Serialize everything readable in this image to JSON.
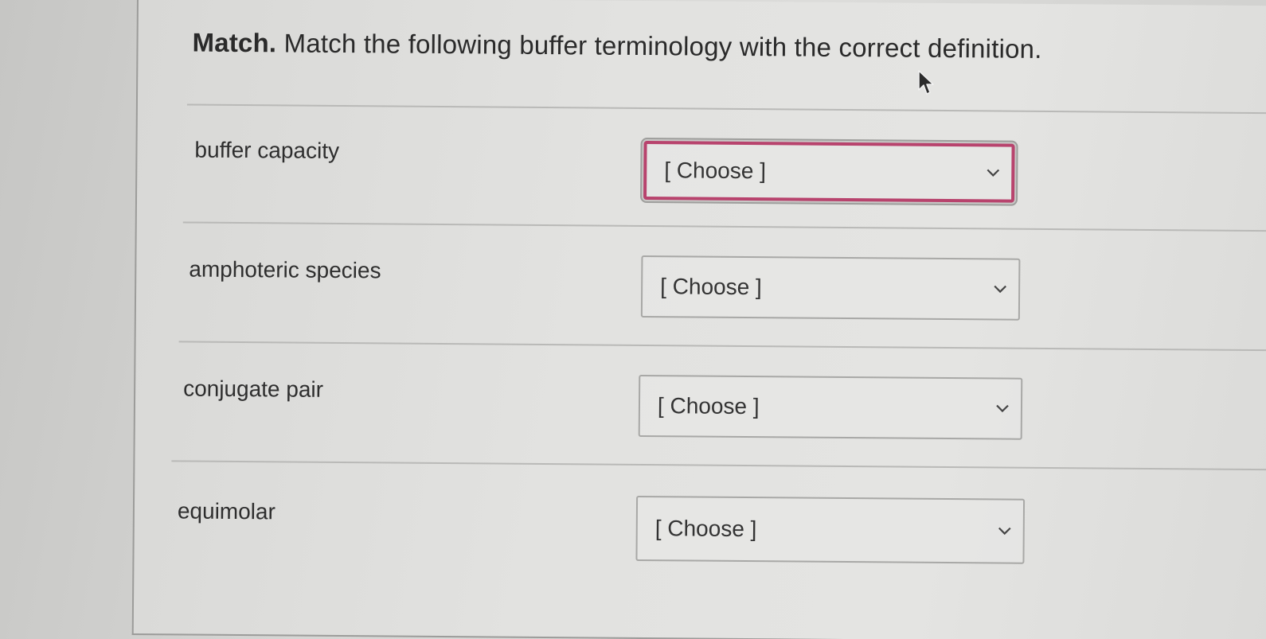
{
  "question": {
    "label": "Match.",
    "prompt": "Match the following buffer terminology with the correct definition."
  },
  "rows": [
    {
      "term": "buffer capacity",
      "selected": "[ Choose ]",
      "focused": true
    },
    {
      "term": "amphoteric species",
      "selected": "[ Choose ]",
      "focused": false
    },
    {
      "term": "conjugate pair",
      "selected": "[ Choose ]",
      "focused": false
    },
    {
      "term": "equimolar",
      "selected": "[ Choose ]",
      "focused": false
    }
  ],
  "colors": {
    "focus_ring": "#b8436d",
    "text": "#2e2e2e"
  },
  "icons": {
    "dropdown": "chevron-down-icon",
    "pointer": "mouse-cursor-icon"
  }
}
